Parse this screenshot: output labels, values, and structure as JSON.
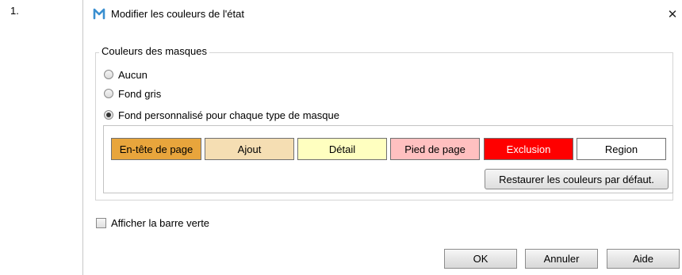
{
  "step_number": "1.",
  "dialog": {
    "title": "Modifier les couleurs de l'état",
    "logo_letter": "M",
    "close_glyph": "✕",
    "group": {
      "legend": "Couleurs des masques",
      "radio_options": [
        {
          "label": "Aucun",
          "checked": false
        },
        {
          "label": "Fond gris",
          "checked": false
        },
        {
          "label": "Fond personnalisé pour chaque type de masque",
          "checked": true
        }
      ],
      "swatches": [
        {
          "label": "En-tête de page",
          "color": "#e8a53c"
        },
        {
          "label": "Ajout",
          "color": "#f5deb3"
        },
        {
          "label": "Détail",
          "color": "#ffffc0"
        },
        {
          "label": "Pied de page",
          "color": "#ffc0c0"
        },
        {
          "label": "Exclusion",
          "color": "#ff0000"
        },
        {
          "label": "Region",
          "color": "#ffffff"
        }
      ],
      "restore_button": "Restaurer les couleurs par défaut."
    },
    "show_green_bar": {
      "label": "Afficher la barre verte",
      "checked": false
    },
    "buttons": {
      "ok": "OK",
      "cancel": "Annuler",
      "help": "Aide"
    }
  }
}
